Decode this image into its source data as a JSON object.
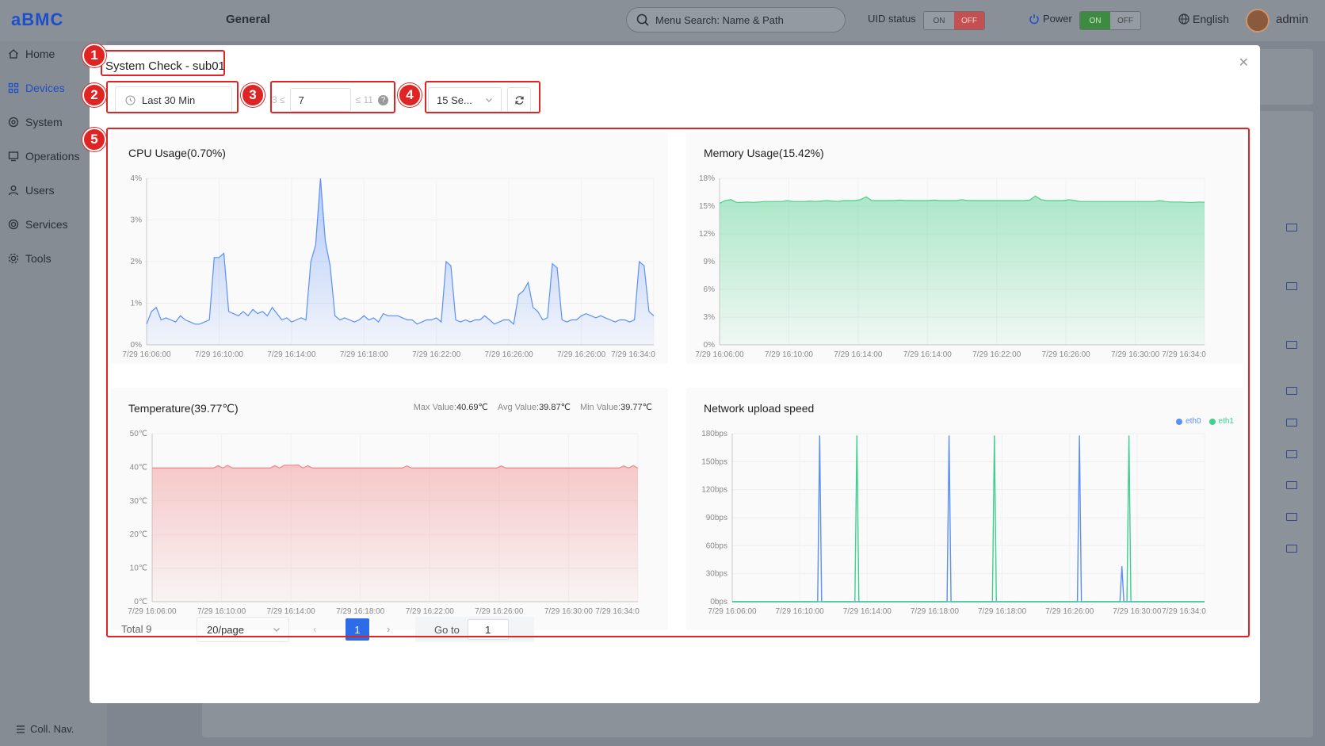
{
  "app": {
    "logo": "aBMC",
    "breadcrumb": "General"
  },
  "header": {
    "search_placeholder": "Menu Search: Name & Path",
    "uid_label": "UID status",
    "uid_on": "ON",
    "uid_off": "OFF",
    "power_label": "Power",
    "power_on": "ON",
    "power_off": "OFF",
    "language": "English",
    "user": "admin"
  },
  "sidebar": {
    "items": [
      {
        "label": "Home",
        "icon": "home-icon"
      },
      {
        "label": "Devices",
        "icon": "devices-icon",
        "active": true
      },
      {
        "label": "System",
        "icon": "system-icon"
      },
      {
        "label": "Operations",
        "icon": "operations-icon"
      },
      {
        "label": "Users",
        "icon": "users-icon"
      },
      {
        "label": "Services",
        "icon": "services-icon"
      },
      {
        "label": "Tools",
        "icon": "tools-icon"
      }
    ],
    "collapse": "Coll. Nav."
  },
  "modal": {
    "title": "System Check - sub01",
    "time_range": "Last 30 Min",
    "range_min_label": "3 ≤",
    "range_value": "7",
    "range_max_label": "≤ 11",
    "interval": "15 Se...",
    "annotations": [
      "1",
      "2",
      "3",
      "4",
      "5"
    ]
  },
  "charts": {
    "cpu": {
      "title": "CPU Usage(0.70%)"
    },
    "mem": {
      "title": "Memory Usage(15.42%)"
    },
    "temp": {
      "title": "Temperature(39.77℃)",
      "max_label": "Max Value:",
      "max_value": "40.69℃",
      "avg_label": "Avg Value:",
      "avg_value": "39.87℃",
      "min_label": "Min Value:",
      "min_value": "39.77℃"
    },
    "net": {
      "title": "Network upload speed"
    }
  },
  "pagination": {
    "total": "Total 9",
    "page_size": "20/page",
    "current_page": "1",
    "goto_label": "Go to",
    "goto_value": "1"
  },
  "chart_data": [
    {
      "type": "area",
      "title": "CPU Usage(0.70%)",
      "ylim": [
        0,
        4
      ],
      "yticks": [
        "0%",
        "1%",
        "2%",
        "3%",
        "4%"
      ],
      "xticks": [
        "7/29 16:06:00",
        "7/29 16:10:00",
        "7/29 16:14:00",
        "7/29 16:18:00",
        "7/29 16:22:00",
        "7/29 16:26:00",
        "7/29 16:26:00",
        "7/29 16:34:0"
      ],
      "color": "#5b8ff9",
      "series": [
        {
          "values": [
            0.5,
            0.8,
            0.9,
            0.6,
            0.65,
            0.6,
            0.55,
            0.7,
            0.6,
            0.55,
            0.5,
            0.5,
            0.55,
            0.6,
            2.1,
            2.1,
            2.2,
            0.8,
            0.75,
            0.7,
            0.8,
            0.7,
            0.85,
            0.75,
            0.8,
            0.7,
            0.9,
            0.75,
            0.6,
            0.65,
            0.55,
            0.6,
            0.65,
            0.6,
            2.0,
            2.4,
            4.0,
            2.5,
            1.9,
            0.7,
            0.6,
            0.65,
            0.6,
            0.55,
            0.6,
            0.7,
            0.6,
            0.65,
            0.55,
            0.75,
            0.7,
            0.7,
            0.7,
            0.65,
            0.6,
            0.6,
            0.5,
            0.55,
            0.6,
            0.6,
            0.65,
            0.55,
            2.0,
            1.9,
            0.6,
            0.55,
            0.6,
            0.55,
            0.6,
            0.6,
            0.7,
            0.6,
            0.5,
            0.55,
            0.6,
            0.6,
            0.5,
            1.2,
            1.3,
            1.5,
            0.9,
            0.8,
            0.6,
            0.65,
            1.95,
            1.85,
            0.6,
            0.55,
            0.6,
            0.6,
            0.7,
            0.75,
            0.7,
            0.65,
            0.7,
            0.65,
            0.6,
            0.55,
            0.6,
            0.6,
            0.55,
            0.6,
            2.0,
            1.9,
            0.8,
            0.7
          ]
        }
      ]
    },
    {
      "type": "area",
      "title": "Memory Usage(15.42%)",
      "ylim": [
        0,
        18
      ],
      "yticks": [
        "0%",
        "3%",
        "6%",
        "9%",
        "12%",
        "15%",
        "18%"
      ],
      "xticks": [
        "7/29 16:06:00",
        "7/29 16:10:00",
        "7/29 16:14:00",
        "7/29 16:14:00",
        "7/29 16:22:00",
        "7/29 16:26:00",
        "7/29 16:30:00",
        "7/29 16:34:0"
      ],
      "color": "#4ccf8a",
      "series": [
        {
          "values": [
            15.3,
            15.6,
            15.7,
            15.4,
            15.4,
            15.45,
            15.4,
            15.45,
            15.5,
            15.5,
            15.5,
            15.5,
            15.6,
            15.5,
            15.5,
            15.5,
            15.55,
            15.5,
            15.55,
            15.6,
            15.55,
            15.5,
            15.6,
            15.6,
            15.6,
            15.7,
            16.0,
            15.6,
            15.6,
            15.6,
            15.6,
            15.6,
            15.65,
            15.6,
            15.6,
            15.6,
            15.6,
            15.6,
            15.65,
            15.6,
            15.6,
            15.6,
            15.6,
            15.7,
            15.6,
            15.6,
            15.6,
            15.6,
            15.6,
            15.6,
            15.6,
            15.6,
            15.6,
            15.6,
            15.6,
            15.65,
            16.1,
            15.7,
            15.6,
            15.6,
            15.6,
            15.6,
            15.7,
            15.6,
            15.5,
            15.5,
            15.5,
            15.5,
            15.5,
            15.5,
            15.5,
            15.5,
            15.5,
            15.5,
            15.5,
            15.5,
            15.5,
            15.5,
            15.6,
            15.5,
            15.45,
            15.45,
            15.45,
            15.4,
            15.4,
            15.45,
            15.42
          ]
        }
      ]
    },
    {
      "type": "area",
      "title": "Temperature(39.77℃)",
      "ylim": [
        0,
        50
      ],
      "yticks": [
        "0℃",
        "10℃",
        "20℃",
        "30℃",
        "40℃",
        "50℃"
      ],
      "xticks": [
        "7/29 16:06:00",
        "7/29 16:10:00",
        "7/29 16:14:00",
        "7/29 16:18:00",
        "7/29 16:22:00",
        "7/29 16:26:00",
        "7/29 16:30:00",
        "7/29 16:34:0"
      ],
      "color": "#f08b8b",
      "series": [
        {
          "values": [
            39.77,
            39.77,
            39.77,
            39.77,
            39.77,
            39.77,
            39.77,
            39.77,
            39.77,
            39.77,
            39.77,
            39.77,
            39.77,
            39.77,
            40.5,
            39.77,
            40.6,
            39.77,
            39.77,
            39.77,
            39.77,
            39.77,
            39.77,
            39.77,
            39.77,
            39.77,
            40.5,
            39.77,
            40.6,
            40.6,
            40.6,
            40.69,
            39.77,
            40.5,
            39.77,
            39.77,
            39.77,
            39.77,
            39.77,
            39.77,
            39.77,
            39.77,
            39.77,
            39.77,
            39.77,
            39.77,
            39.77,
            39.77,
            39.77,
            39.77,
            39.77,
            39.77,
            39.77,
            39.77,
            40.4,
            39.77,
            39.77,
            39.77,
            39.77,
            39.77,
            39.77,
            39.77,
            39.77,
            39.77,
            39.77,
            39.77,
            39.77,
            39.77,
            39.77,
            39.77,
            39.77,
            39.77,
            39.77,
            39.77,
            40.4,
            39.77,
            39.77,
            39.77,
            39.77,
            39.77,
            39.77,
            39.77,
            39.77,
            39.77,
            39.77,
            39.77,
            39.77,
            39.77,
            39.77,
            39.77,
            39.77,
            39.77,
            39.77,
            39.77,
            39.77,
            39.77,
            39.77,
            39.77,
            39.77,
            39.77,
            40.4,
            39.77,
            40.5,
            39.77
          ]
        }
      ]
    },
    {
      "type": "line",
      "title": "Network upload speed",
      "ylim": [
        0,
        180
      ],
      "yticks": [
        "0bps",
        "30bps",
        "60bps",
        "90bps",
        "120bps",
        "150bps",
        "180bps"
      ],
      "xticks": [
        "7/29 16:06:00",
        "7/29 16:10:00",
        "7/29 16:14:00",
        "7/29 16:18:00",
        "7/29 16:18:00",
        "7/29 16:26:00",
        "7/29 16:30:00",
        "7/29 16:34:0"
      ],
      "legend": [
        "eth0",
        "eth1"
      ],
      "series": [
        {
          "name": "eth0",
          "color": "#5b8ff9",
          "spikes": [
            [
              0.185,
              178
            ],
            [
              0.459,
              178
            ],
            [
              0.735,
              178
            ],
            [
              0.825,
              38
            ]
          ]
        },
        {
          "name": "eth1",
          "color": "#3fcf8e",
          "spikes": [
            [
              0.264,
              178
            ],
            [
              0.555,
              178
            ],
            [
              0.84,
              178
            ]
          ]
        }
      ]
    }
  ]
}
